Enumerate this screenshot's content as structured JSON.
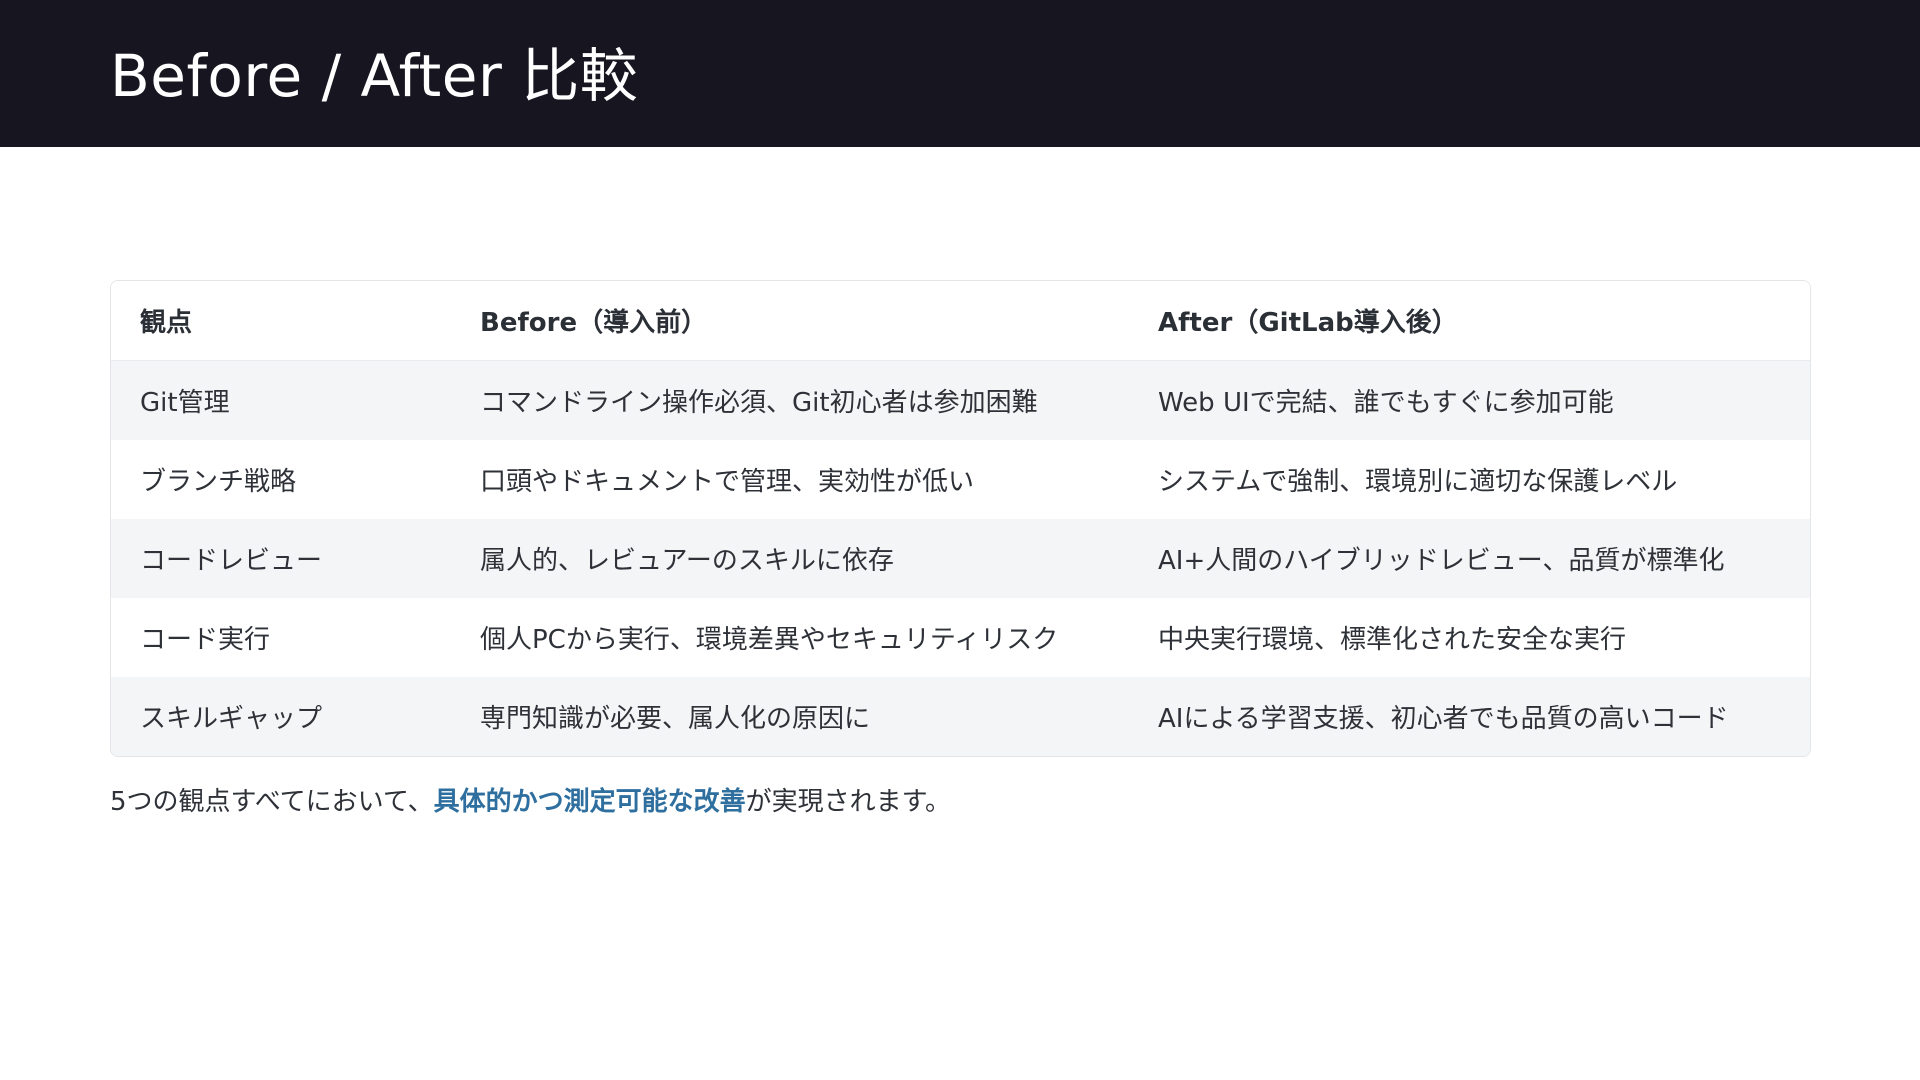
{
  "slide": {
    "title": "Before / After 比較"
  },
  "table": {
    "headers": [
      "観点",
      "Before（導入前）",
      "After（GitLab導入後）"
    ],
    "rows": [
      [
        "Git管理",
        "コマンドライン操作必須、Git初心者は参加困難",
        "Web UIで完結、誰でもすぐに参加可能"
      ],
      [
        "ブランチ戦略",
        "口頭やドキュメントで管理、実効性が低い",
        "システムで強制、環境別に適切な保護レベル"
      ],
      [
        "コードレビュー",
        "属人的、レビュアーのスキルに依存",
        "AI+人間のハイブリッドレビュー、品質が標準化"
      ],
      [
        "コード実行",
        "個人PCから実行、環境差異やセキュリティリスク",
        "中央実行環境、標準化された安全な実行"
      ],
      [
        "スキルギャップ",
        "専門知識が必要、属人化の原因に",
        "AIによる学習支援、初心者でも品質の高いコード"
      ]
    ]
  },
  "summary": {
    "prefix": "5つの観点すべてにおいて、",
    "highlight": "具体的かつ測定可能な改善",
    "suffix": "が実現されます。"
  },
  "colors": {
    "header_band": "#17151f",
    "highlight": "#2f6f9f",
    "row_stripe": "#f4f5f6"
  }
}
